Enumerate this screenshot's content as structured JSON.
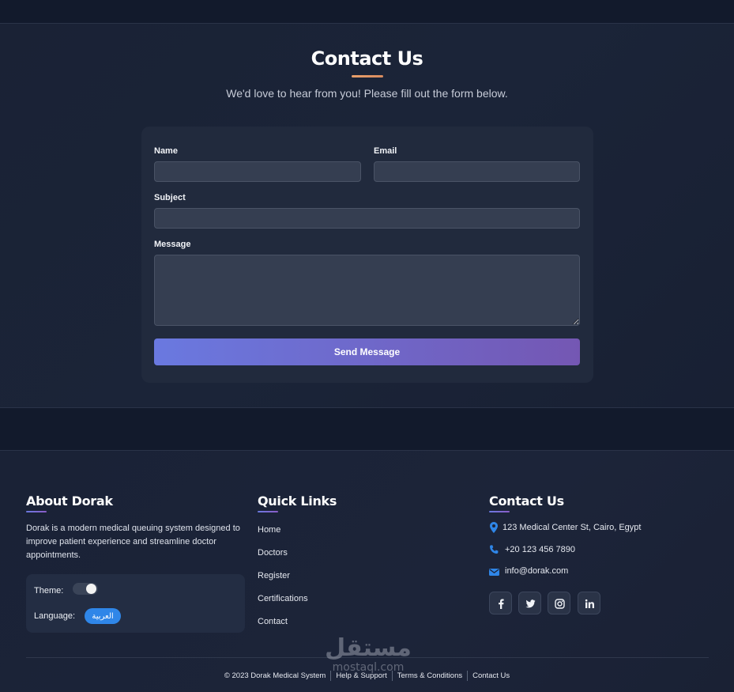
{
  "contact": {
    "title": "Contact Us",
    "subtitle": "We'd love to hear from you! Please fill out the form below.",
    "form": {
      "name_label": "Name",
      "name_value": "",
      "email_label": "Email",
      "email_value": "",
      "subject_label": "Subject",
      "subject_value": "",
      "message_label": "Message",
      "message_value": "",
      "submit_label": "Send Message"
    }
  },
  "footer": {
    "about": {
      "heading": "About Dorak",
      "text": "Dorak is a modern medical queuing system designed to improve patient experience and streamline doctor appointments.",
      "theme_label": "Theme:",
      "theme_toggle_on": true,
      "language_label": "Language:",
      "language_button": "العربية"
    },
    "quick_links": {
      "heading": "Quick Links",
      "items": [
        "Home",
        "Doctors",
        "Register",
        "Certifications",
        "Contact"
      ]
    },
    "contact": {
      "heading": "Contact Us",
      "address": "123 Medical Center St, Cairo, Egypt",
      "phone": "+20 123 456 7890",
      "email": "info@dorak.com",
      "social": [
        "facebook-icon",
        "twitter-icon",
        "instagram-icon",
        "linkedin-icon"
      ]
    },
    "bottom": {
      "copyright": "© 2023 Dorak Medical System",
      "links": [
        "Help & Support",
        "Terms & Conditions",
        "Contact Us"
      ]
    }
  },
  "watermark": {
    "arabic": "مستقل",
    "latin": "mostaql.com"
  },
  "colors": {
    "accent_gradient_start": "#6a79e0",
    "accent_gradient_end": "#7457b3",
    "title_underline": "#e8a06b",
    "icon_blue": "#2f86e8",
    "language_button": "#2f86e8"
  }
}
